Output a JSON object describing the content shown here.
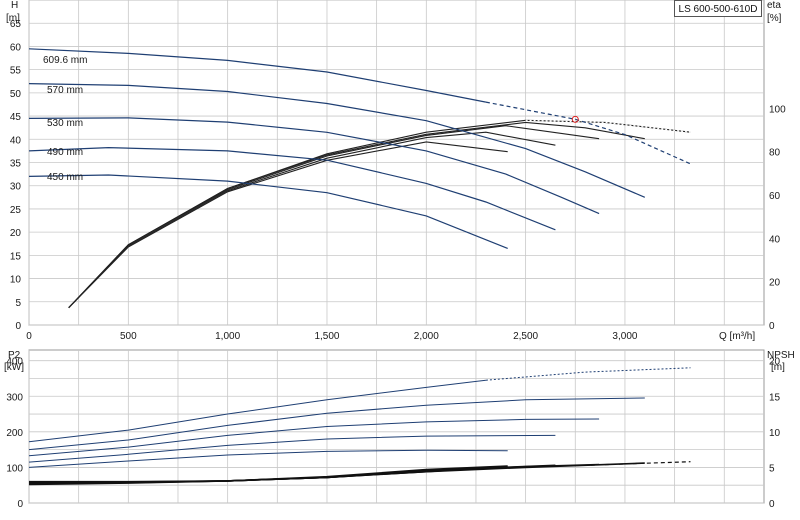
{
  "model_label": "LS 600-500-610D",
  "colors": {
    "curve": "#1f3f73",
    "eff": "#222222",
    "grid": "#c8c8c8",
    "marker": "#e02020"
  },
  "top_panel": {
    "left_title": "H",
    "left_unit": "[m]",
    "right_title": "eta",
    "right_unit": "[%]",
    "x_label": "Q [m³/h]",
    "x_ticks": [
      "0",
      "500",
      "1,000",
      "1,500",
      "2,000",
      "2,500",
      "3,000"
    ],
    "y_ticks": [
      "0",
      "5",
      "10",
      "15",
      "20",
      "25",
      "30",
      "35",
      "40",
      "45",
      "50",
      "55",
      "60",
      "65"
    ],
    "eta_ticks": [
      "0",
      "20",
      "40",
      "60",
      "80",
      "100"
    ],
    "curve_labels": [
      "609.6 mm",
      "570 mm",
      "530 mm",
      "490 mm",
      "450 mm"
    ]
  },
  "bottom_panel": {
    "left_title": "P2",
    "left_unit": "[kW]",
    "right_title": "NPSH",
    "right_unit": "[m]",
    "y_ticks": [
      "0",
      "100",
      "200",
      "300",
      "400"
    ],
    "npsh_ticks": [
      "0",
      "5",
      "10",
      "15",
      "20"
    ]
  },
  "chart_data": [
    {
      "type": "line",
      "title": "",
      "xlabel": "Q [m³/h]",
      "ylabel": "H [m]",
      "y2label": "eta [%]",
      "xlim": [
        0,
        3700
      ],
      "ylim": [
        0,
        70
      ],
      "y2lim": [
        0,
        150
      ],
      "grid": true,
      "head_curves": [
        {
          "name": "609.6 mm",
          "x": [
            0,
            500,
            1000,
            1500,
            2000,
            2300
          ],
          "y": [
            59.5,
            58.5,
            57,
            54.5,
            50.5,
            48
          ],
          "dashed": {
            "x": [
              2300,
              2750,
              3000,
              3330
            ],
            "y": [
              48,
              44.3,
              41,
              34.7
            ]
          }
        },
        {
          "name": "570 mm",
          "x": [
            0,
            500,
            1000,
            1500,
            2000,
            2500,
            2800,
            3100
          ],
          "y": [
            52,
            51.6,
            50.3,
            47.7,
            44,
            38,
            33,
            27.5
          ]
        },
        {
          "name": "530 mm",
          "x": [
            0,
            500,
            1000,
            1500,
            2000,
            2400,
            2680,
            2870
          ],
          "y": [
            44.5,
            44.6,
            43.7,
            41.5,
            37.5,
            32.5,
            27.5,
            24
          ]
        },
        {
          "name": "490 mm",
          "x": [
            0,
            400,
            1000,
            1500,
            2000,
            2300,
            2650
          ],
          "y": [
            37.5,
            38.2,
            37.5,
            35.5,
            30.5,
            26.5,
            20.5
          ]
        },
        {
          "name": "450 mm",
          "x": [
            0,
            400,
            1000,
            1500,
            2000,
            2410
          ],
          "y": [
            32,
            32.3,
            31,
            28.5,
            23.5,
            16.5
          ]
        }
      ],
      "efficiency_curves": [
        {
          "name": "609.6 mm",
          "x": [
            200,
            500,
            1000,
            1500,
            2000,
            2500,
            2900,
            3330
          ],
          "y": [
            8,
            37,
            63,
            79,
            89,
            94.5,
            93.5,
            89
          ]
        },
        {
          "name": "570 mm",
          "x": [
            200,
            500,
            1000,
            1500,
            2000,
            2500,
            2800,
            3100
          ],
          "y": [
            8,
            37,
            63,
            78.5,
            88,
            93.5,
            91,
            86
          ]
        },
        {
          "name": "530 mm",
          "x": [
            200,
            500,
            1000,
            1500,
            2000,
            2400,
            2870
          ],
          "y": [
            8,
            37,
            62.5,
            78,
            87.5,
            92,
            86
          ]
        },
        {
          "name": "490 mm",
          "x": [
            200,
            500,
            1000,
            1500,
            2000,
            2300,
            2650
          ],
          "y": [
            8,
            36.5,
            62,
            77,
            86.5,
            89,
            83
          ]
        },
        {
          "name": "450 mm",
          "x": [
            200,
            500,
            1000,
            1500,
            2000,
            2410
          ],
          "y": [
            8,
            36,
            61.5,
            76,
            84.5,
            80
          ]
        }
      ],
      "duty_point": {
        "x": 2750,
        "y": 44.3
      }
    },
    {
      "type": "line",
      "title": "",
      "xlabel": "Q [m³/h]",
      "ylabel": "P2 [kW]",
      "y2label": "NPSH [m]",
      "xlim": [
        0,
        3700
      ],
      "ylim": [
        0,
        430
      ],
      "y2lim": [
        0,
        21.5
      ],
      "grid": true,
      "power_curves": [
        {
          "name": "609.6 mm",
          "x": [
            0,
            500,
            1000,
            1500,
            2000,
            2300
          ],
          "y": [
            172,
            205,
            250,
            290,
            325,
            345
          ],
          "dashed": {
            "x": [
              2300,
              2800,
              3330
            ],
            "y": [
              345,
              368,
              380
            ]
          }
        },
        {
          "name": "570 mm",
          "x": [
            0,
            500,
            1000,
            1500,
            2000,
            2500,
            3100
          ],
          "y": [
            150,
            177,
            218,
            252,
            275,
            290,
            295
          ]
        },
        {
          "name": "530 mm",
          "x": [
            0,
            500,
            1000,
            1500,
            2000,
            2500,
            2870
          ],
          "y": [
            133,
            157,
            190,
            215,
            228,
            235,
            236
          ]
        },
        {
          "name": "490 mm",
          "x": [
            0,
            500,
            1000,
            1500,
            2000,
            2650
          ],
          "y": [
            115,
            137,
            162,
            180,
            188,
            190
          ]
        },
        {
          "name": "450 mm",
          "x": [
            0,
            500,
            1000,
            1500,
            2000,
            2410
          ],
          "y": [
            100,
            118,
            135,
            145,
            148,
            147
          ]
        }
      ],
      "npsh_curves": [
        {
          "name": "609.6 mm",
          "x": [
            0,
            500,
            1000,
            1500,
            2000,
            2300
          ],
          "y": [
            3,
            3,
            3.1,
            3.6,
            4.4,
            4.9
          ],
          "dashed": {
            "x": [
              2300,
              2800,
              3330
            ],
            "y": [
              4.9,
              5.3,
              5.8
            ]
          }
        },
        {
          "name": "570 mm",
          "x": [
            0,
            500,
            1000,
            1500,
            2000,
            2500,
            3100
          ],
          "y": [
            2.9,
            2.95,
            3.1,
            3.6,
            4.4,
            5.0,
            5.6
          ]
        },
        {
          "name": "530 mm",
          "x": [
            0,
            500,
            1000,
            1500,
            2000,
            2500,
            2870
          ],
          "y": [
            2.8,
            2.9,
            3.1,
            3.6,
            4.5,
            5.1,
            5.4
          ]
        },
        {
          "name": "490 mm",
          "x": [
            0,
            500,
            1000,
            1500,
            2000,
            2650
          ],
          "y": [
            2.7,
            2.85,
            3.1,
            3.6,
            4.6,
            5.3
          ]
        },
        {
          "name": "450 mm",
          "x": [
            0,
            500,
            1000,
            1500,
            2000,
            2410
          ],
          "y": [
            2.6,
            2.8,
            3.1,
            3.7,
            4.7,
            5.2
          ]
        }
      ]
    }
  ]
}
